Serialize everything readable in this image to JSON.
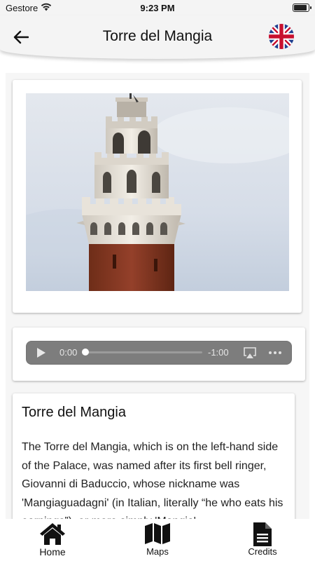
{
  "status_bar": {
    "carrier": "Gestore",
    "time": "9:23 PM"
  },
  "header": {
    "title": "Torre del Mangia",
    "back_icon": "arrow-left-icon",
    "language_icon": "uk-flag-icon"
  },
  "audio": {
    "current_time": "0:00",
    "remaining_time": "-1:00",
    "progress_fraction": 0
  },
  "article": {
    "title": "Torre del Mangia",
    "body": "The Torre del Mangia, which is on the left-hand side of the Palace, was named after its first bell ringer, Giovanni di Baduccio, whose nickname was 'Mangiaguadagni' (in Italian, literally “he who eats his earnings”), or more simply 'Mangia'."
  },
  "tab_bar": {
    "tabs": [
      {
        "label": "Home",
        "icon": "home-icon"
      },
      {
        "label": "Maps",
        "icon": "map-icon"
      },
      {
        "label": "Credits",
        "icon": "document-icon"
      }
    ]
  },
  "colors": {
    "header_bg": "#f4f4f4",
    "audio_player_bg": "#7d7d7d",
    "tower_brick": "#8a3a20",
    "sky": "#dde3ec"
  }
}
